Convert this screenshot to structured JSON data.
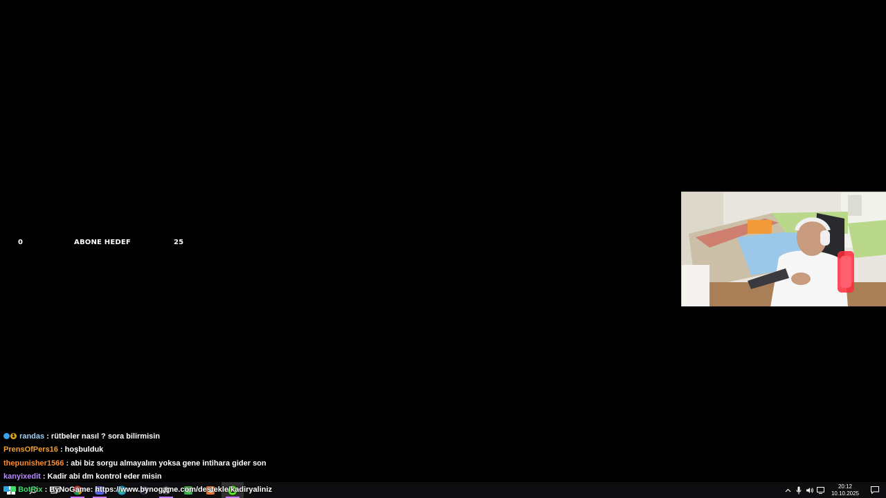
{
  "goal": {
    "start": "0",
    "label": "ABONE HEDEF",
    "end": "25"
  },
  "chat": {
    "messages": [
      {
        "user": "randas",
        "text": ": rütbeler nasıl ? sora bilirmisin",
        "color": "#9fd0f5",
        "badges": [
          "cube-badge",
          "coin-badge"
        ]
      },
      {
        "user": "PrensOfPers16",
        "text": ": hoşbulduk",
        "color": "#f0a030"
      },
      {
        "user": "thepunisher1566",
        "text": ": abi biz sorgu almayalım yoksa gene intihara gider son",
        "color": "#ff8c2a"
      },
      {
        "user": "kanyixedit",
        "text": ": Kadir abi dm kontrol eder misin",
        "color": "#b98cff"
      },
      {
        "user": "BotRix",
        "text": ": ByNoGame: https://www.bynogame.com/destekle/kadiryaliniz",
        "color": "#3ee06a",
        "badges": [
          "bot-badge"
        ]
      }
    ]
  },
  "taskbar": {
    "apps": [
      {
        "icon": "windows-start-icon"
      },
      {
        "icon": "search-icon"
      },
      {
        "icon": "task-view-icon"
      },
      {
        "icon": "chrome-icon"
      },
      {
        "icon": "discord-icon"
      },
      {
        "icon": "edge-icon"
      },
      {
        "icon": "steam-icon"
      },
      {
        "icon": "obs-icon"
      },
      {
        "icon": "app-green-icon"
      },
      {
        "icon": "app-orange-icon"
      },
      {
        "icon": "app-kick-icon",
        "active": true
      }
    ],
    "time": "20:12",
    "date": "10.10.2025"
  },
  "colors": {
    "background": "#000000",
    "taskbar": "#121214",
    "accent": "#c77dff"
  }
}
